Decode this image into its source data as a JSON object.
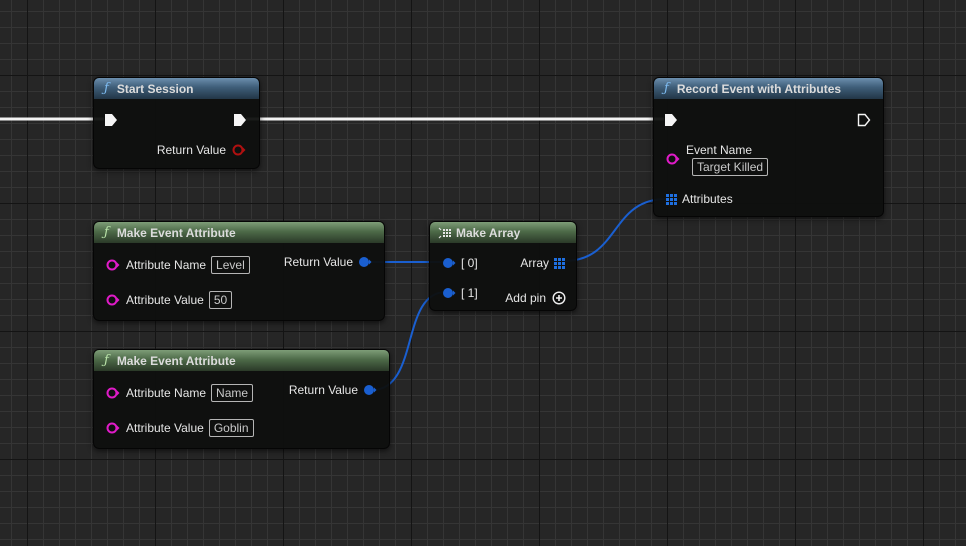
{
  "colors": {
    "exec_wire": "#ffffff",
    "struct_wire": "#1a5fd0",
    "string_pin": "#e01bc8",
    "return_pin_red": "#a01010",
    "struct_pin": "#1a5fd0",
    "function_header_blue": "#3e5d78",
    "pure_header_green": "#4d6a48"
  },
  "nodes": {
    "start_session": {
      "title": "Start Session",
      "icon": "function-icon",
      "outputs": {
        "return_label": "Return Value"
      }
    },
    "record_event": {
      "title": "Record Event with Attributes",
      "icon": "function-icon",
      "inputs": {
        "event_name_label": "Event Name",
        "event_name_value": "Target Killed",
        "attributes_label": "Attributes"
      }
    },
    "make_attr_1": {
      "title": "Make Event Attribute",
      "icon": "function-icon",
      "inputs": {
        "name_label": "Attribute Name",
        "name_value": "Level",
        "value_label": "Attribute Value",
        "value_value": "50"
      },
      "outputs": {
        "return_label": "Return Value"
      }
    },
    "make_attr_2": {
      "title": "Make Event Attribute",
      "icon": "function-icon",
      "inputs": {
        "name_label": "Attribute Name",
        "name_value": "Name",
        "value_label": "Attribute Value",
        "value_value": "Goblin"
      },
      "outputs": {
        "return_label": "Return Value"
      }
    },
    "make_array": {
      "title": "Make Array",
      "icon": "make-array-icon",
      "inputs": {
        "pin0_label": "[ 0]",
        "pin1_label": "[ 1]"
      },
      "outputs": {
        "array_label": "Array",
        "add_pin_label": "Add pin"
      }
    }
  }
}
